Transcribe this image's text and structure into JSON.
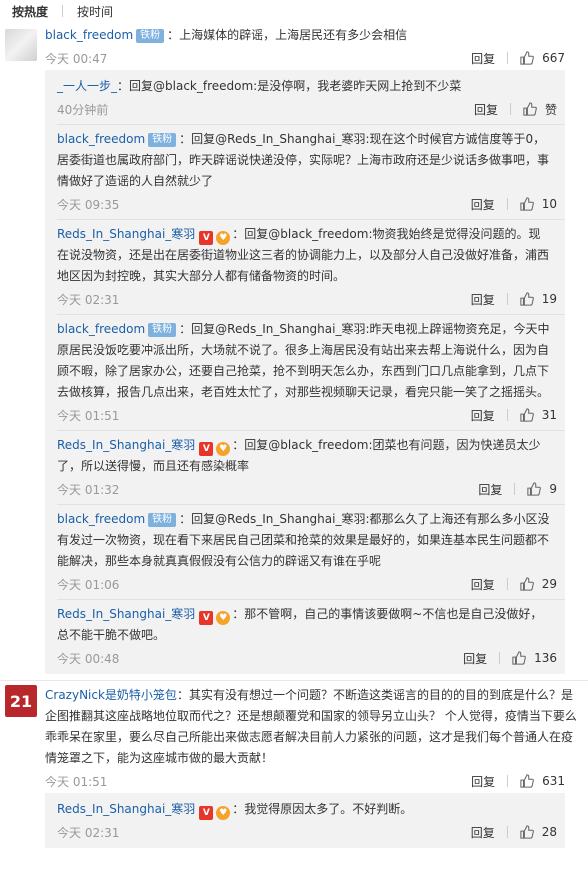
{
  "sort": {
    "hot": "按热度",
    "time": "按时间"
  },
  "labels": {
    "reply": "回复",
    "fan_badge": "铁粉",
    "v_badge": "V"
  },
  "comments": [
    {
      "user": "black_freedom",
      "text": "：上海媒体的辟谣，上海居民还有多少会相信",
      "time": "今天 00:47",
      "likes": "667",
      "replies": [
        {
          "user": "_一人一步_",
          "text": "：回复@black_freedom:是没停啊，我老婆昨天网上抢到不少菜",
          "time": "40分钟前",
          "likes": "赞"
        },
        {
          "user": "black_freedom",
          "text": "：回复@Reds_In_Shanghai_寒羽:现在这个时候官方诚信度等于0，居委街道也属政府部门，昨天辟谣说快递没停，实际呢？上海市政府还是少说话多做事吧，事情做好了造谣的人自然就少了",
          "time": "今天 09:35",
          "likes": "10"
        },
        {
          "user": "Reds_In_Shanghai_寒羽",
          "text": "：回复@black_freedom:物资我始终是觉得没问题的。现在说没物资，还是出在居委街道物业这三者的协调能力上，以及部分人自己没做好准备，浦西地区因为封控晚，其实大部分人都有储备物资的时间。",
          "time": "今天 02:31",
          "likes": "19"
        },
        {
          "user": "black_freedom",
          "text": "：回复@Reds_In_Shanghai_寒羽:昨天电视上辟谣物资充足，今天中原居民没饭吃要冲派出所，大场就不说了。很多上海居民没有站出来去帮上海说什么，因为自顾不暇，除了居家办公，还要自己抢菜，抢不到明天怎么办，东西到门口几点能拿到，几点下去做核算，报告几点出来，老百姓太忙了，对那些视频聊天记录，看完只能一笑了之摇摇头。",
          "time": "今天 01:51",
          "likes": "31"
        },
        {
          "user": "Reds_In_Shanghai_寒羽",
          "text": "：回复@black_freedom:团菜也有问题，因为快递员太少了，所以送得慢，而且还有感染概率",
          "time": "今天 01:32",
          "likes": "9"
        },
        {
          "user": "black_freedom",
          "text": "：回复@Reds_In_Shanghai_寒羽:都那么久了上海还有那么多小区没有发过一次物资，现在看下来居民自己团菜和抢菜的效果是最好的，如果连基本民生问题都不能解决，那些本身就真真假假没有公信力的辟谣又有谁在乎呢",
          "time": "今天 01:06",
          "likes": "29"
        },
        {
          "user": "Reds_In_Shanghai_寒羽",
          "text": "：那不管啊，自己的事情该要做啊~不信也是自己没做好，总不能干脆不做吧。",
          "time": "今天 00:48",
          "likes": "136"
        }
      ]
    },
    {
      "user": "CrazyNick是奶特小笼包",
      "text": "：其实有没有想过一个问题？不断造这类谣言的目的的目的到底是什么？是企图推翻其这座战略地位取而代之？还是想颠覆党和国家的领导另立山头？ 个人觉得，疫情当下要么乖乖呆在家里，要么尽自己所能出来做志愿者解决目前人力紧张的问题，这才是我们每个普通人在疫情笼罩之下，能为这座城市做的最大贡献！",
      "time": "今天 01:51",
      "likes": "631",
      "avatar_text": "21",
      "replies": [
        {
          "user": "Reds_In_Shanghai_寒羽",
          "text": "：我觉得原因太多了。不好判断。",
          "time": "今天 02:31",
          "likes": "28"
        }
      ]
    }
  ]
}
